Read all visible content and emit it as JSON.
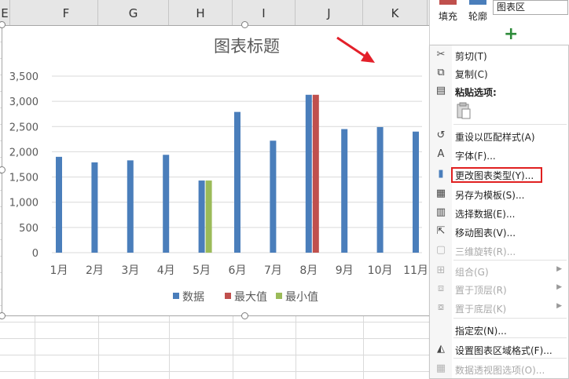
{
  "sheet": {
    "columns": [
      "E",
      "F",
      "G",
      "H",
      "I",
      "J",
      "K"
    ]
  },
  "chart_data": {
    "type": "bar",
    "title": "图表标题",
    "categories": [
      "1月",
      "2月",
      "3月",
      "4月",
      "5月",
      "6月",
      "7月",
      "8月",
      "9月",
      "10月",
      "11月"
    ],
    "series": [
      {
        "name": "数据",
        "color": "#4a7ebb",
        "values": [
          1900,
          1790,
          1830,
          1940,
          1430,
          2790,
          2220,
          3130,
          2450,
          2490,
          2400
        ]
      },
      {
        "name": "最大值",
        "color": "#c0504d",
        "values": [
          null,
          null,
          null,
          null,
          null,
          null,
          null,
          3130,
          null,
          null,
          null
        ]
      },
      {
        "name": "最小值",
        "color": "#9bbb59",
        "values": [
          null,
          null,
          null,
          null,
          1430,
          null,
          null,
          null,
          null,
          null,
          null
        ]
      }
    ],
    "ylim": [
      0,
      3500
    ],
    "yticks": [
      "0",
      "500",
      "1,000",
      "1,500",
      "2,000",
      "2,500",
      "3,000",
      "3,500"
    ],
    "grid": true,
    "legend": "bottom"
  },
  "ribbon": {
    "fill_label": "填充",
    "fill_color": "#c0504d",
    "outline_label": "轮廓",
    "outline_color": "#4a7ebb",
    "chart_area_dropdown": "图表区",
    "add_element_icon": "plus-icon"
  },
  "context_menu": {
    "items": [
      {
        "id": "cut",
        "icon": "scissors-icon",
        "label": "剪切(T)",
        "disabled": false
      },
      {
        "id": "copy",
        "icon": "copy-icon",
        "label": "复制(C)",
        "disabled": false
      },
      {
        "id": "paste-options",
        "icon": "paste-icon",
        "label": "粘贴选项:",
        "disabled": false
      },
      {
        "id": "reset-style",
        "icon": "reset-style-icon",
        "label": "重设以匹配样式(A)",
        "disabled": false
      },
      {
        "id": "font",
        "icon": "font-icon",
        "label": "字体(F)...",
        "disabled": false
      },
      {
        "id": "change-chart-type",
        "icon": "chart-type-icon",
        "label": "更改图表类型(Y)...",
        "disabled": false
      },
      {
        "id": "save-template",
        "icon": "template-icon",
        "label": "另存为模板(S)...",
        "disabled": false
      },
      {
        "id": "select-data",
        "icon": "select-data-icon",
        "label": "选择数据(E)...",
        "disabled": false
      },
      {
        "id": "move-chart",
        "icon": "move-chart-icon",
        "label": "移动图表(V)...",
        "disabled": false
      },
      {
        "id": "3d-rotation",
        "icon": "cube-icon",
        "label": "三维旋转(R)...",
        "disabled": true
      },
      {
        "id": "group",
        "icon": "group-icon",
        "label": "组合(G)",
        "disabled": true
      },
      {
        "id": "bring-front",
        "icon": "bring-front-icon",
        "label": "置于顶层(R)",
        "disabled": true
      },
      {
        "id": "send-back",
        "icon": "send-back-icon",
        "label": "置于底层(K)",
        "disabled": true
      },
      {
        "id": "assign-macro",
        "icon": "",
        "label": "指定宏(N)...",
        "disabled": false
      },
      {
        "id": "format-chart-area",
        "icon": "format-area-icon",
        "label": "设置图表区域格式(F)...",
        "disabled": false
      },
      {
        "id": "pivot-options",
        "icon": "pivot-icon",
        "label": "数据透视图选项(O)...",
        "disabled": true
      }
    ],
    "highlight_color": "#e02020"
  }
}
